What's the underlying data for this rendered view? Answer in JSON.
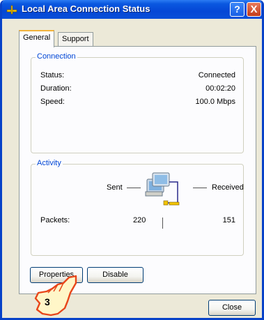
{
  "window": {
    "title": "Local Area Connection Status",
    "help_label": "?",
    "close_glyph": "X"
  },
  "tabs": [
    {
      "label": "General",
      "active": true
    },
    {
      "label": "Support",
      "active": false
    }
  ],
  "connection": {
    "legend": "Connection",
    "rows": [
      {
        "label": "Status:",
        "value": "Connected"
      },
      {
        "label": "Duration:",
        "value": "00:02:20"
      },
      {
        "label": "Speed:",
        "value": "100.0 Mbps"
      }
    ]
  },
  "activity": {
    "legend": "Activity",
    "sent_label": "Sent",
    "received_label": "Received",
    "packets_label": "Packets:",
    "packets_sent": "220",
    "packets_received": "151"
  },
  "buttons": {
    "properties": "Properties",
    "disable": "Disable",
    "close": "Close"
  },
  "callout": {
    "number": "3"
  },
  "icons": {
    "title": "network-plug-icon",
    "activity": "network-computers-icon",
    "pointer": "hand-pointer-icon"
  },
  "colors": {
    "title_bar": "#0547d6",
    "legend_text": "#0046d5",
    "dialog_bg": "#ece9d8",
    "close_button": "#c33b1a"
  }
}
